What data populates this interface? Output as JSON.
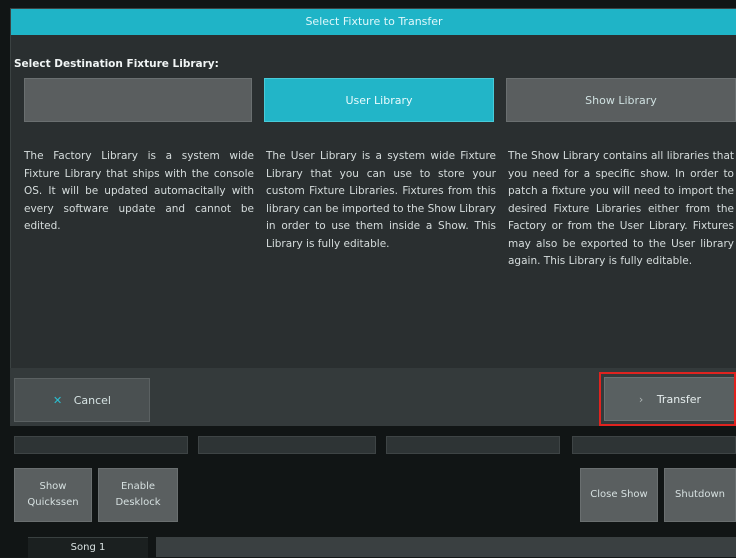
{
  "dialog": {
    "title": "Select Fixture to Transfer",
    "section_label": "Select Destination Fixture Library:"
  },
  "library_buttons": [
    {
      "label": "",
      "active": false
    },
    {
      "label": "User Library",
      "active": true
    },
    {
      "label": "Show Library",
      "active": false
    }
  ],
  "descriptions": [
    "The Factory Library is a system wide Fixture Library that ships with the console OS. It will be updated automacitally with every software update and cannot be edited.",
    "The User Library is a system wide Fixture Library that you can use to store your custom Fixture Libraries. Fixtures from this library can be imported to the Show Library in order to use them inside a Show. This Library is fully editable.",
    "The Show Library contains all libraries that you need for a specific show. In order to patch a fixture you will need to import the desired Fixture Libraries either from the Factory or from the User Library. Fixtures may also be exported to the User library again. This Library is fully editable."
  ],
  "actions": {
    "cancel_label": "Cancel",
    "transfer_label": "Transfer"
  },
  "bottom_buttons": {
    "show_quickssen": "Show Quickssen",
    "enable_desklock": "Enable Desklock",
    "close_show": "Close Show",
    "shutdown": "Shutdown"
  },
  "song_tab": "Song 1",
  "colors": {
    "accent": "#22b5c8",
    "highlight": "#e0231f",
    "panel": "#2a2f30"
  }
}
